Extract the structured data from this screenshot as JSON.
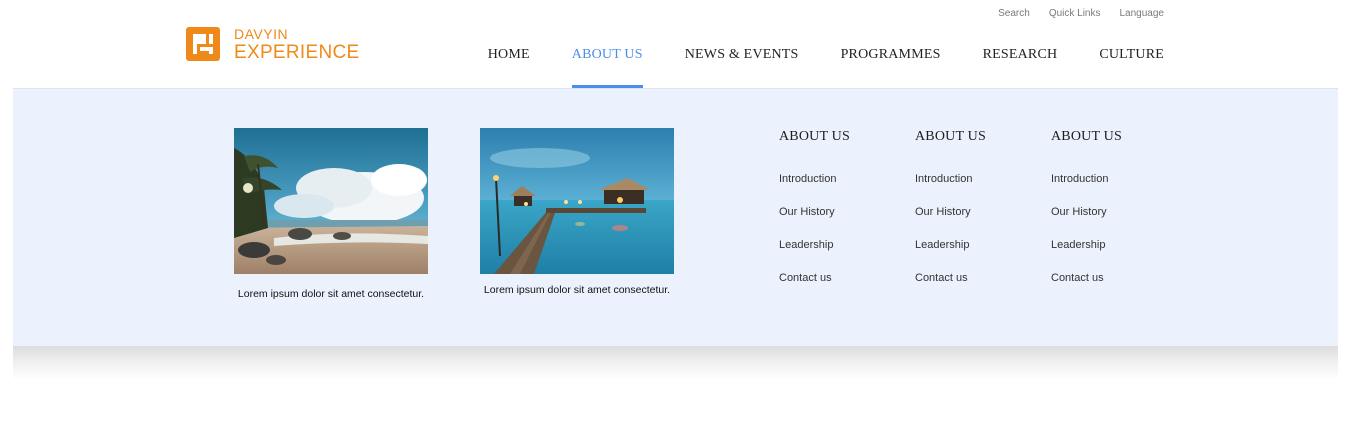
{
  "brand": {
    "name_top": "DAVYIN",
    "name_bottom": "EXPERIENCE",
    "color": "#EF8A1A"
  },
  "utility_nav": [
    "Search",
    "Quick Links",
    "Language"
  ],
  "main_nav": [
    {
      "label": "HOME",
      "active": false
    },
    {
      "label": "ABOUT US",
      "active": true
    },
    {
      "label": "NEWS & EVENTS",
      "active": false
    },
    {
      "label": "PROGRAMMES",
      "active": false
    },
    {
      "label": "RESEARCH",
      "active": false
    },
    {
      "label": "CULTURE",
      "active": false
    }
  ],
  "accent_color": "#4A8FE8",
  "dropdown": {
    "background": "#EBF2FD",
    "features": [
      {
        "image": "beach-photo",
        "caption": "Lorem ipsum dolor sit amet consectetur."
      },
      {
        "image": "pier-photo",
        "caption": "Lorem ipsum dolor sit amet consectetur."
      }
    ],
    "columns": [
      {
        "title": "ABOUT US",
        "links": [
          "Introduction",
          "Our History",
          "Leadership",
          "Contact us"
        ]
      },
      {
        "title": "ABOUT US",
        "links": [
          "Introduction",
          "Our History",
          "Leadership",
          "Contact us"
        ]
      },
      {
        "title": "ABOUT US",
        "links": [
          "Introduction",
          "Our History",
          "Leadership",
          "Contact us"
        ]
      }
    ]
  }
}
